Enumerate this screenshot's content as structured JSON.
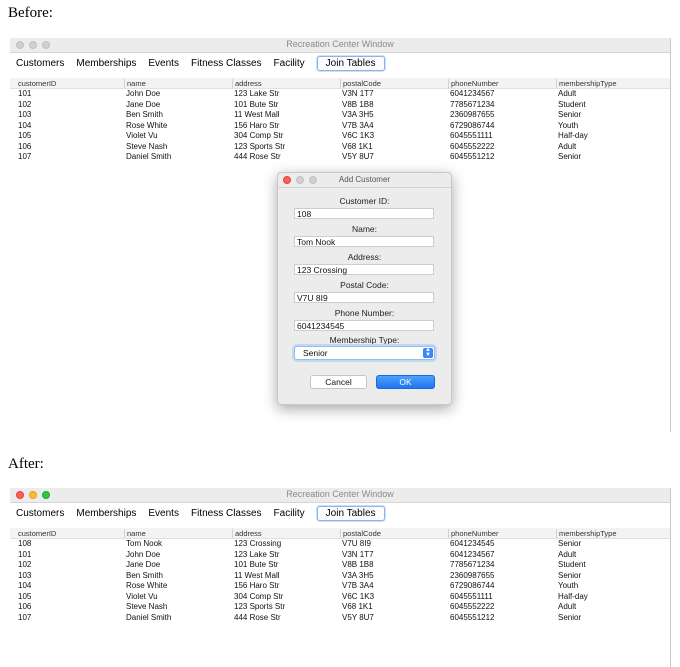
{
  "labels": {
    "before": "Before:",
    "after": "After:"
  },
  "window": {
    "title": "Recreation Center Window",
    "menu": [
      "Customers",
      "Memberships",
      "Events",
      "Fitness Classes",
      "Facility",
      "Join Tables"
    ],
    "selected_menu": "Join Tables"
  },
  "table": {
    "columns": [
      "customerID",
      "name",
      "address",
      "postalCode",
      "phoneNumber",
      "membershipType"
    ]
  },
  "before_rows": [
    [
      "101",
      "John Doe",
      "123 Lake Str",
      "V3N 1T7",
      "6041234567",
      "Adult"
    ],
    [
      "102",
      "Jane Doe",
      "101 Bute Str",
      "V8B 1B8",
      "7785671234",
      "Student"
    ],
    [
      "103",
      "Ben Smith",
      "11 West Mall",
      "V3A 3H5",
      "2360987655",
      "Senior"
    ],
    [
      "104",
      "Rose White",
      "156 Haro Str",
      "V7B 3A4",
      "6729086744",
      "Youth"
    ],
    [
      "105",
      "Violet Vu",
      "304 Comp Str",
      "V6C 1K3",
      "6045551111",
      "Half-day"
    ],
    [
      "106",
      "Steve Nash",
      "123 Sports Str",
      "V68 1K1",
      "6045552222",
      "Adult"
    ],
    [
      "107",
      "Daniel Smith",
      "444 Rose Str",
      "V5Y 8U7",
      "6045551212",
      "Senior"
    ]
  ],
  "after_rows": [
    [
      "108",
      "Tom Nook",
      "123 Crossing",
      "V7U 8I9",
      "6041234545",
      "Senior"
    ],
    [
      "101",
      "John Doe",
      "123 Lake Str",
      "V3N 1T7",
      "6041234567",
      "Adult"
    ],
    [
      "102",
      "Jane Doe",
      "101 Bute Str",
      "V8B 1B8",
      "7785671234",
      "Student"
    ],
    [
      "103",
      "Ben Smith",
      "11 West Mall",
      "V3A 3H5",
      "2360987655",
      "Senior"
    ],
    [
      "104",
      "Rose White",
      "156 Haro Str",
      "V7B 3A4",
      "6729086744",
      "Youth"
    ],
    [
      "105",
      "Violet Vu",
      "304 Comp Str",
      "V6C 1K3",
      "6045551111",
      "Half-day"
    ],
    [
      "106",
      "Steve Nash",
      "123 Sports Str",
      "V68 1K1",
      "6045552222",
      "Adult"
    ],
    [
      "107",
      "Daniel Smith",
      "444 Rose Str",
      "V5Y 8U7",
      "6045551212",
      "Senior"
    ]
  ],
  "dialog": {
    "title": "Add Customer",
    "fields": [
      {
        "label": "Customer ID:",
        "value": "108"
      },
      {
        "label": "Name:",
        "value": "Tom Nook"
      },
      {
        "label": "Address:",
        "value": "123 Crossing"
      },
      {
        "label": "Postal Code:",
        "value": "V7U 8I9"
      },
      {
        "label": "Phone Number:",
        "value": "6041234545"
      }
    ],
    "membership_label": "Membership Type:",
    "membership_value": "Senior",
    "cancel_label": "Cancel",
    "ok_label": "OK"
  },
  "colors": {
    "accent": "#1f74f2",
    "close": "#fc5f57",
    "minimize": "#fdbc2e",
    "zoom": "#28c840"
  },
  "icons": [
    "close-light",
    "minimize-light",
    "zoom-light",
    "chevron-updown-icon"
  ]
}
